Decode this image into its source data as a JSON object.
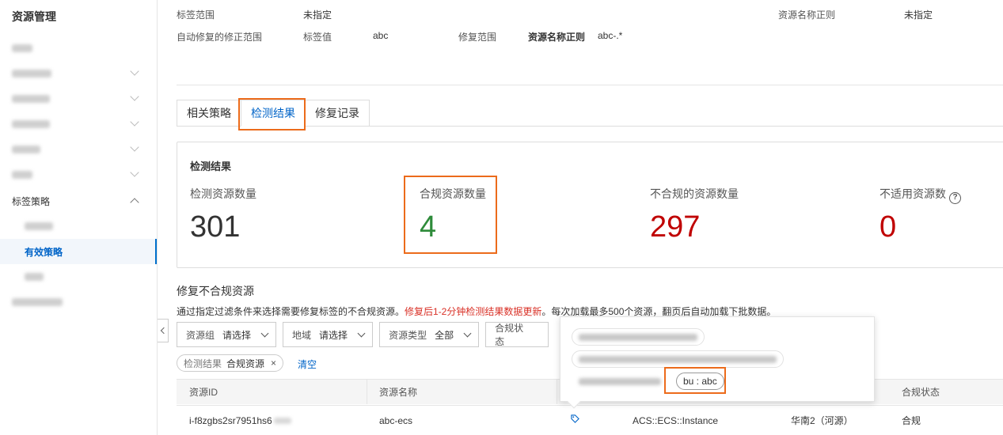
{
  "sidebar": {
    "title": "资源管理",
    "tag_policy_group": "标签策略",
    "active_item": "有效策略"
  },
  "header_info": {
    "tag_scope_label": "标签范围",
    "tag_scope_value": "未指定",
    "resource_name_regex_label": "资源名称正则",
    "resource_name_regex_value": "未指定",
    "auto_fix_label": "自动修复的修正范围",
    "tag_value_label": "标签值",
    "tag_value": "abc",
    "fix_scope_label": "修复范围",
    "fix_resource_name_regex_label": "资源名称正则",
    "fix_resource_name_regex_value": "abc-.*"
  },
  "tabs": [
    "相关策略",
    "检测结果",
    "修复记录"
  ],
  "results": {
    "title": "检测结果",
    "stats": [
      {
        "label": "检测资源数量",
        "value": "301",
        "color": "#333333"
      },
      {
        "label": "合规资源数量",
        "value": "4",
        "color": "#2e8b3a"
      },
      {
        "label": "不合规的资源数量",
        "value": "297",
        "color": "#c00000"
      },
      {
        "label": "不适用资源数",
        "value": "0",
        "color": "#c00000"
      }
    ],
    "help_icon": "?"
  },
  "fix_section": {
    "title": "修复不合规资源",
    "desc_prefix": "通过指定过滤条件来选择需要修复标签的不合规资源。",
    "desc_warning": "修复后1-2分钟检测结果数据更新",
    "desc_suffix": "。每次加载最多500个资源，翻页后自动加载下批数据。"
  },
  "filters": [
    {
      "key": "资源组",
      "value": "请选择"
    },
    {
      "key": "地域",
      "value": "请选择"
    },
    {
      "key": "资源类型",
      "value": "全部"
    },
    {
      "key": "合规状态",
      "value": ""
    }
  ],
  "active_filter": {
    "key": "检测结果",
    "value": "合规资源",
    "remove": "×"
  },
  "clear_label": "清空",
  "table": {
    "headers": [
      "资源ID",
      "资源名称",
      "",
      "",
      "",
      "合规状态"
    ],
    "rows": [
      {
        "id": "i-f8zgbs2sr7951hs6",
        "name": "abc-ecs",
        "type": "ACS::ECS::Instance",
        "region": "华南2（河源）",
        "status": "合规"
      }
    ]
  },
  "popover": {
    "visible_tag": "bu : abc"
  }
}
